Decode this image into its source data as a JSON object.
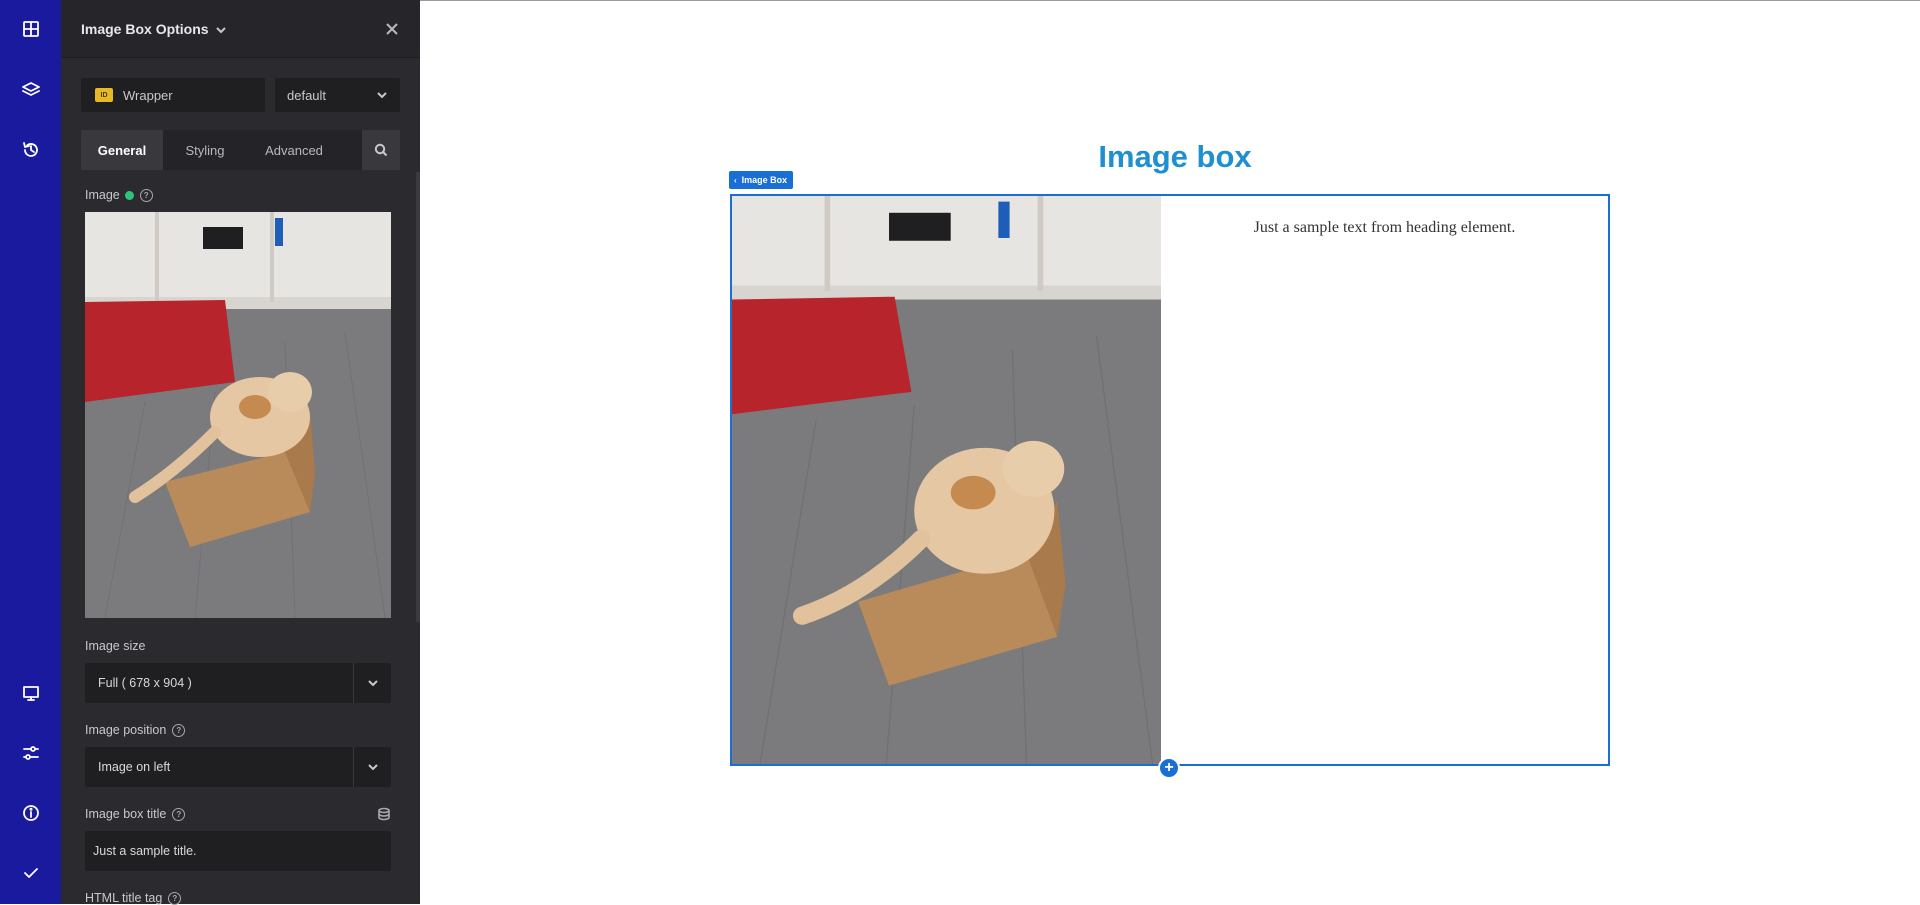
{
  "panel": {
    "title": "Image Box Options",
    "wrapper": {
      "badge": "ID",
      "label": "Wrapper"
    },
    "preset": "default",
    "tabs": [
      {
        "label": "General",
        "active": true
      },
      {
        "label": "Styling",
        "active": false
      },
      {
        "label": "Advanced",
        "active": false
      }
    ],
    "fields": {
      "image_label": "Image",
      "image_size_label": "Image size",
      "image_size_value": "Full ( 678 x 904 )",
      "image_position_label": "Image position",
      "image_position_value": "Image on left",
      "image_box_title_label": "Image box title",
      "image_box_title_value": "Just a sample title.",
      "html_title_tag_label": "HTML title tag"
    }
  },
  "rail": {
    "top_icons": [
      "layout-icon",
      "layers-icon",
      "history-icon"
    ],
    "bottom_icons": [
      "desktop-icon",
      "sliders-icon",
      "info-icon",
      "check-icon"
    ],
    "color": "#1a1a9e"
  },
  "canvas": {
    "heading": "Image box",
    "element_tag": "Image Box",
    "box_text": "Just a sample text from heading element.",
    "accent": "#1a6fd6",
    "heading_color": "#1e8fd1"
  }
}
